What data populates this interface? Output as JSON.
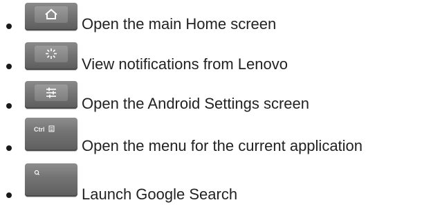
{
  "items": [
    {
      "key_icon": "home-icon",
      "description": "Open the main Home screen"
    },
    {
      "key_icon": "notification-icon",
      "description": "View notifications from Lenovo"
    },
    {
      "key_icon": "settings-sliders-icon",
      "description": "Open the Android Settings screen"
    },
    {
      "key_icon": "menu-icon",
      "key_legend": "Ctrl",
      "description": "Open the menu for the current application"
    },
    {
      "key_icon": "search-icon",
      "description": "Launch Google Search"
    }
  ]
}
